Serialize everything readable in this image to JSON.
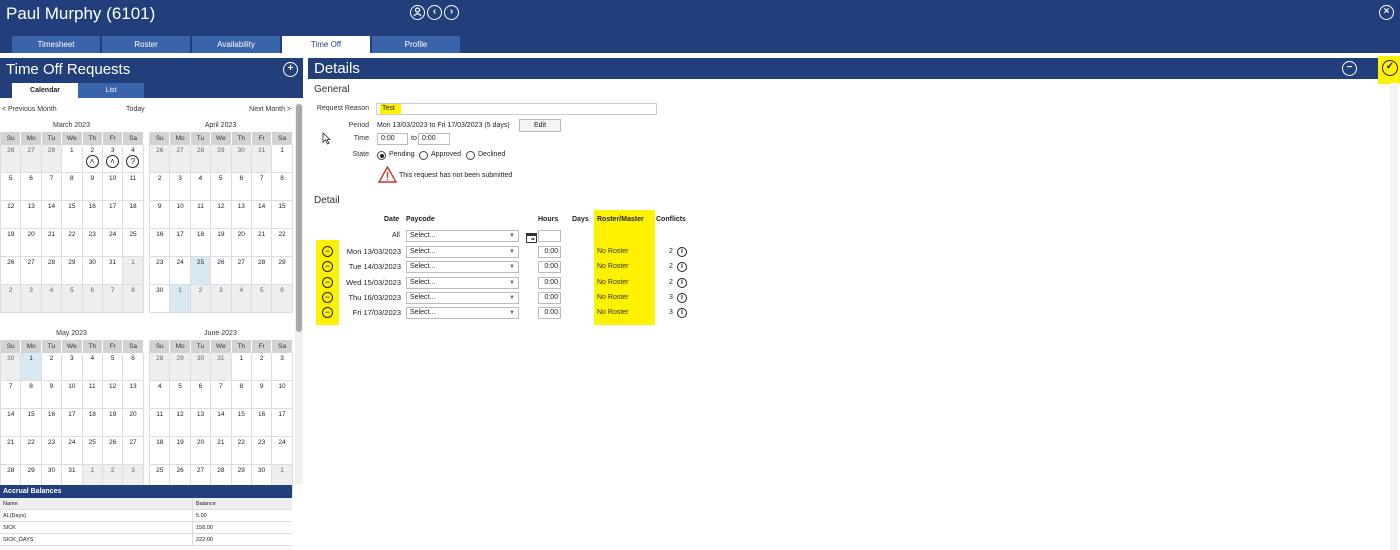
{
  "header": {
    "title": "Paul Murphy (6101)",
    "tabs": [
      {
        "label": "Timesheet",
        "active": false
      },
      {
        "label": "Roster",
        "active": false
      },
      {
        "label": "Availability",
        "active": false
      },
      {
        "label": "Time Off",
        "active": true
      },
      {
        "label": "Profile",
        "active": false
      }
    ],
    "icons": [
      "person-icon",
      "chevron-left-icon",
      "chevron-right-icon",
      "close-icon"
    ]
  },
  "left": {
    "title": "Time Off Requests",
    "subtabs": [
      "Calendar",
      "List"
    ],
    "nav": {
      "prev": "< Previous Month",
      "today": "Today",
      "next": "Next Month >"
    },
    "dow": [
      "Su",
      "Mo",
      "Tu",
      "We",
      "Th",
      "Fr",
      "Sa"
    ],
    "months": [
      {
        "name": "March 2023",
        "days": [
          [
            "26",
            "o"
          ],
          [
            "27",
            "o"
          ],
          [
            "28",
            "o"
          ],
          [
            "1",
            ""
          ],
          [
            "2",
            "up"
          ],
          [
            "3",
            "up"
          ],
          [
            "4",
            "q"
          ],
          [
            "5",
            ""
          ],
          [
            "6",
            ""
          ],
          [
            "7",
            ""
          ],
          [
            "8",
            ""
          ],
          [
            "9",
            ""
          ],
          [
            "10",
            ""
          ],
          [
            "11",
            ""
          ],
          [
            "12",
            ""
          ],
          [
            "13",
            ""
          ],
          [
            "14",
            ""
          ],
          [
            "15",
            ""
          ],
          [
            "16",
            ""
          ],
          [
            "17",
            ""
          ],
          [
            "18",
            ""
          ],
          [
            "19",
            ""
          ],
          [
            "20",
            ""
          ],
          [
            "21",
            ""
          ],
          [
            "22",
            ""
          ],
          [
            "23",
            ""
          ],
          [
            "24",
            ""
          ],
          [
            "25",
            ""
          ],
          [
            "26",
            ""
          ],
          [
            "27",
            ""
          ],
          [
            "28",
            ""
          ],
          [
            "29",
            ""
          ],
          [
            "30",
            ""
          ],
          [
            "31",
            ""
          ],
          [
            "1",
            "o"
          ],
          [
            "2",
            "o"
          ],
          [
            "3",
            "o"
          ],
          [
            "4",
            "o"
          ],
          [
            "5",
            "o"
          ],
          [
            "6",
            "o"
          ],
          [
            "7",
            "o"
          ],
          [
            "8",
            "o"
          ]
        ]
      },
      {
        "name": "April 2023",
        "days": [
          [
            "26",
            "o"
          ],
          [
            "27",
            "o"
          ],
          [
            "28",
            "o"
          ],
          [
            "29",
            "o"
          ],
          [
            "30",
            "o"
          ],
          [
            "31",
            "o"
          ],
          [
            "1",
            ""
          ],
          [
            "2",
            ""
          ],
          [
            "3",
            ""
          ],
          [
            "4",
            ""
          ],
          [
            "5",
            ""
          ],
          [
            "6",
            ""
          ],
          [
            "7",
            ""
          ],
          [
            "8",
            ""
          ],
          [
            "9",
            ""
          ],
          [
            "10",
            ""
          ],
          [
            "11",
            ""
          ],
          [
            "12",
            ""
          ],
          [
            "13",
            ""
          ],
          [
            "14",
            ""
          ],
          [
            "15",
            ""
          ],
          [
            "16",
            ""
          ],
          [
            "17",
            ""
          ],
          [
            "18",
            ""
          ],
          [
            "19",
            ""
          ],
          [
            "20",
            ""
          ],
          [
            "21",
            ""
          ],
          [
            "22",
            ""
          ],
          [
            "23",
            ""
          ],
          [
            "24",
            ""
          ],
          [
            "25",
            "h"
          ],
          [
            "26",
            ""
          ],
          [
            "27",
            ""
          ],
          [
            "28",
            ""
          ],
          [
            "29",
            ""
          ],
          [
            "30",
            ""
          ],
          [
            "1",
            "oh"
          ],
          [
            "2",
            "o"
          ],
          [
            "3",
            "o"
          ],
          [
            "4",
            "o"
          ],
          [
            "5",
            "o"
          ],
          [
            "6",
            "o"
          ]
        ]
      },
      {
        "name": "May 2023",
        "days": [
          [
            "30",
            "o"
          ],
          [
            "1",
            "h"
          ],
          [
            "2",
            ""
          ],
          [
            "3",
            ""
          ],
          [
            "4",
            ""
          ],
          [
            "5",
            ""
          ],
          [
            "6",
            ""
          ],
          [
            "7",
            ""
          ],
          [
            "8",
            ""
          ],
          [
            "9",
            ""
          ],
          [
            "10",
            ""
          ],
          [
            "11",
            ""
          ],
          [
            "12",
            ""
          ],
          [
            "13",
            ""
          ],
          [
            "14",
            ""
          ],
          [
            "15",
            ""
          ],
          [
            "16",
            ""
          ],
          [
            "17",
            ""
          ],
          [
            "18",
            ""
          ],
          [
            "19",
            ""
          ],
          [
            "20",
            ""
          ],
          [
            "21",
            ""
          ],
          [
            "22",
            ""
          ],
          [
            "23",
            ""
          ],
          [
            "24",
            ""
          ],
          [
            "25",
            ""
          ],
          [
            "26",
            ""
          ],
          [
            "27",
            ""
          ],
          [
            "28",
            ""
          ],
          [
            "29",
            ""
          ],
          [
            "30",
            ""
          ],
          [
            "31",
            ""
          ],
          [
            "1",
            "o"
          ],
          [
            "2",
            "o"
          ],
          [
            "3",
            "o"
          ]
        ]
      },
      {
        "name": "June 2023",
        "days": [
          [
            "28",
            "o"
          ],
          [
            "29",
            "o"
          ],
          [
            "30",
            "o"
          ],
          [
            "31",
            "o"
          ],
          [
            "1",
            ""
          ],
          [
            "2",
            ""
          ],
          [
            "3",
            ""
          ],
          [
            "4",
            ""
          ],
          [
            "5",
            ""
          ],
          [
            "6",
            ""
          ],
          [
            "7",
            ""
          ],
          [
            "8",
            ""
          ],
          [
            "9",
            ""
          ],
          [
            "10",
            ""
          ],
          [
            "11",
            ""
          ],
          [
            "12",
            ""
          ],
          [
            "13",
            ""
          ],
          [
            "14",
            ""
          ],
          [
            "15",
            ""
          ],
          [
            "16",
            ""
          ],
          [
            "17",
            ""
          ],
          [
            "18",
            ""
          ],
          [
            "19",
            ""
          ],
          [
            "20",
            ""
          ],
          [
            "21",
            ""
          ],
          [
            "22",
            ""
          ],
          [
            "23",
            ""
          ],
          [
            "24",
            ""
          ],
          [
            "25",
            ""
          ],
          [
            "26",
            ""
          ],
          [
            "27",
            ""
          ],
          [
            "28",
            ""
          ],
          [
            "29",
            ""
          ],
          [
            "30",
            ""
          ],
          [
            "1",
            "o"
          ]
        ]
      }
    ],
    "accrual": {
      "title": "Accrual Balances",
      "col_name": "Name",
      "col_balance": "Balance",
      "rows": [
        {
          "name": "AL(Days)",
          "balance": "5.00"
        },
        {
          "name": "SICK",
          "balance": "158.00"
        },
        {
          "name": "SICK_DAYS",
          "balance": "222.00"
        }
      ]
    }
  },
  "details": {
    "title": "Details",
    "general_title": "General",
    "request_reason_label": "Request Reason",
    "request_reason_value": "Test",
    "period_label": "Period",
    "period_value": "Mon 13/03/2023 to Fri 17/03/2023 (5 days)",
    "edit_label": "Edit",
    "time_label": "Time",
    "time_from": "0:00",
    "time_to_label": "to",
    "time_to": "0:00",
    "state_label": "State",
    "states": [
      {
        "label": "Pending",
        "selected": true
      },
      {
        "label": "Approved",
        "selected": false
      },
      {
        "label": "Declined",
        "selected": false
      }
    ],
    "warning": "This request has not been submitted",
    "detail_title": "Detail",
    "columns": {
      "date": "Date",
      "paycode": "Paycode",
      "hours": "Hours",
      "days": "Days",
      "roster": "Roster/Master",
      "conflicts": "Conflicts"
    },
    "all_label": "All",
    "all_paycode": "Select...",
    "rows": [
      {
        "date": "Mon 13/03/2023",
        "paycode": "Select...",
        "hours": "0:00",
        "roster": "No Roster",
        "conflicts": "2"
      },
      {
        "date": "Tue 14/03/2023",
        "paycode": "Select...",
        "hours": "0:00",
        "roster": "No Roster",
        "conflicts": "2"
      },
      {
        "date": "Wed 15/03/2023",
        "paycode": "Select...",
        "hours": "0:00",
        "roster": "No Roster",
        "conflicts": "2"
      },
      {
        "date": "Thu 16/03/2023",
        "paycode": "Select...",
        "hours": "0:00",
        "roster": "No Roster",
        "conflicts": "3"
      },
      {
        "date": "Fri 17/03/2023",
        "paycode": "Select...",
        "hours": "0:00",
        "roster": "No Roster",
        "conflicts": "3"
      }
    ]
  },
  "colors": {
    "header": "#233f7b",
    "tab": "#3a64a9",
    "highlight": "#fff200",
    "warning": "#c0392b"
  }
}
